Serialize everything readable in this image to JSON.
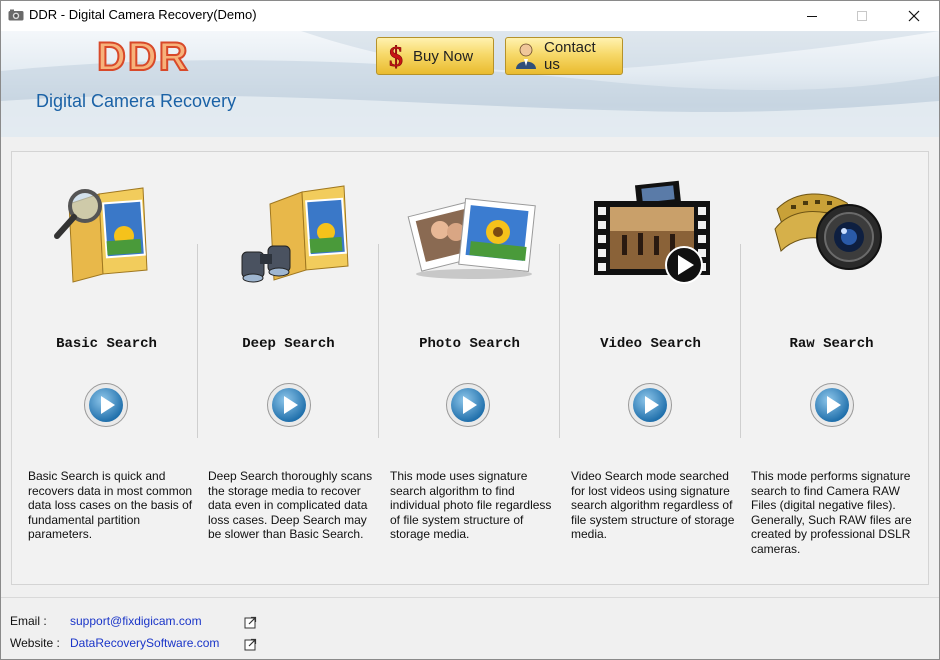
{
  "window": {
    "title": "DDR - Digital Camera Recovery(Demo)",
    "controls": [
      "minimize-icon",
      "maximize-icon",
      "close-icon"
    ]
  },
  "header": {
    "logo": "DDR",
    "subtitle": "Digital Camera Recovery",
    "buy_now": "Buy Now",
    "contact_us": "Contact us",
    "accent_color": "#1b62a6",
    "button_color": "#f7d96a"
  },
  "modes": [
    {
      "label": "Basic Search",
      "icon": "folder-magnifier-icon",
      "description": "Basic Search is quick and recovers data in most common data loss cases on the basis of fundamental partition parameters."
    },
    {
      "label": "Deep Search",
      "icon": "folder-binoculars-icon",
      "description": "Deep Search thoroughly scans the storage media to recover data even in complicated data loss cases. Deep Search may be slower than Basic Search."
    },
    {
      "label": "Photo Search",
      "icon": "photos-icon",
      "description": "This mode uses signature search algorithm to find individual photo file regardless of file system structure of storage media."
    },
    {
      "label": "Video Search",
      "icon": "video-film-icon",
      "description": "Video Search mode searched for lost videos using signature search algorithm regardless of file system structure of storage media."
    },
    {
      "label": "Raw Search",
      "icon": "camera-lens-film-icon",
      "description": "This mode performs signature search to find Camera RAW Files (digital negative files). Generally, Such RAW files are created by professional DSLR cameras."
    }
  ],
  "footer": {
    "email_label": "Email :",
    "email_value": "support@fixdigicam.com",
    "website_label": "Website :",
    "website_value": "DataRecoverySoftware.com",
    "link_color": "#1a35c8"
  }
}
